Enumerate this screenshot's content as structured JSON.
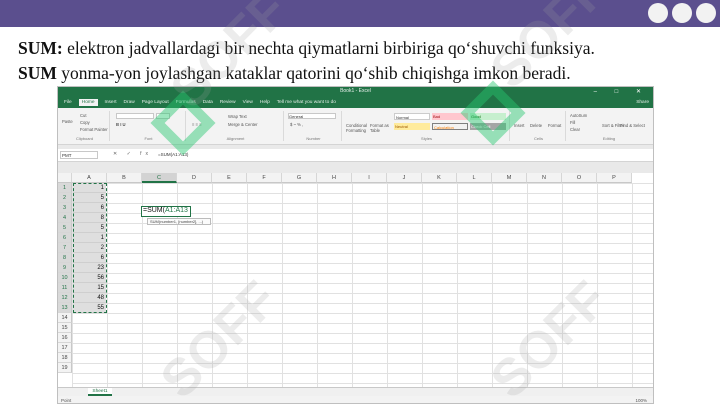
{
  "slide": {
    "line1_term": "SUM:",
    "line1_text": " elektron  jadvallardagi bir nechta qiymatlarni birbiriga qo‘shuvchi funksiya.",
    "line2_term": "SUM",
    "line2_text": " yonma-yon joylashgan kataklar qatorini qo‘shib chiqishga imkon beradi."
  },
  "colors": {
    "topbar": "#5b4f8e",
    "excel_green": "#217346",
    "watermark_green": "#26c86e"
  },
  "excel": {
    "title": "Book1 - Excel",
    "window_controls": "–  □  ✕",
    "menu": [
      "File",
      "Home",
      "Insert",
      "Draw",
      "Page Layout",
      "Formulas",
      "Data",
      "Review",
      "View",
      "Help",
      "Tell me what you want to do"
    ],
    "share": "Share",
    "ribbon": {
      "clipboard": "Clipboard",
      "paste": "Paste",
      "cut": "Cut",
      "copy": "Copy",
      "format_painter": "Format Painter",
      "font": "Font",
      "alignment": "Alignment",
      "wrap_text": "Wrap Text",
      "merge": "Merge & Center",
      "number": "Number",
      "number_format": "General",
      "styles": "Styles",
      "conditional": "Conditional Formatting",
      "format_as_table": "Format as Table",
      "style_normal": "Normal",
      "style_bad": "Bad",
      "style_good": "Good",
      "style_neutral": "Neutral",
      "style_calculation": "Calculation",
      "style_check": "Check Cell",
      "cells": "Cells",
      "insert": "Insert",
      "delete": "Delete",
      "format": "Format",
      "editing": "Editing",
      "autosum": "AutoSum",
      "fill": "Fill",
      "clear": "Clear",
      "sort": "Sort & Filter",
      "find": "Find & Select"
    },
    "name_box": "PMT",
    "fx_icons": "✕ ✓ fx",
    "formula": "=SUM(A1:A13)",
    "columns": [
      "A",
      "B",
      "C",
      "D",
      "E",
      "F",
      "G",
      "H",
      "I",
      "J",
      "K",
      "L",
      "M",
      "N",
      "O",
      "P"
    ],
    "rows": [
      "1",
      "2",
      "3",
      "4",
      "5",
      "6",
      "7",
      "8",
      "9",
      "10",
      "11",
      "12",
      "13",
      "14",
      "15",
      "16",
      "17",
      "18",
      "19"
    ],
    "values": [
      "1",
      "5",
      "6",
      "8",
      "5",
      "1",
      "2",
      "6",
      "23",
      "56",
      "15",
      "48",
      "55"
    ],
    "active_cell_prefix": "=SUM(",
    "active_cell_ref": "A1:A13",
    "tooltip": "SUM(number1, [number2], ...)",
    "sheet_tab": "Sheet1",
    "status": "Point",
    "zoom": "100%"
  },
  "watermark": "SOFF"
}
